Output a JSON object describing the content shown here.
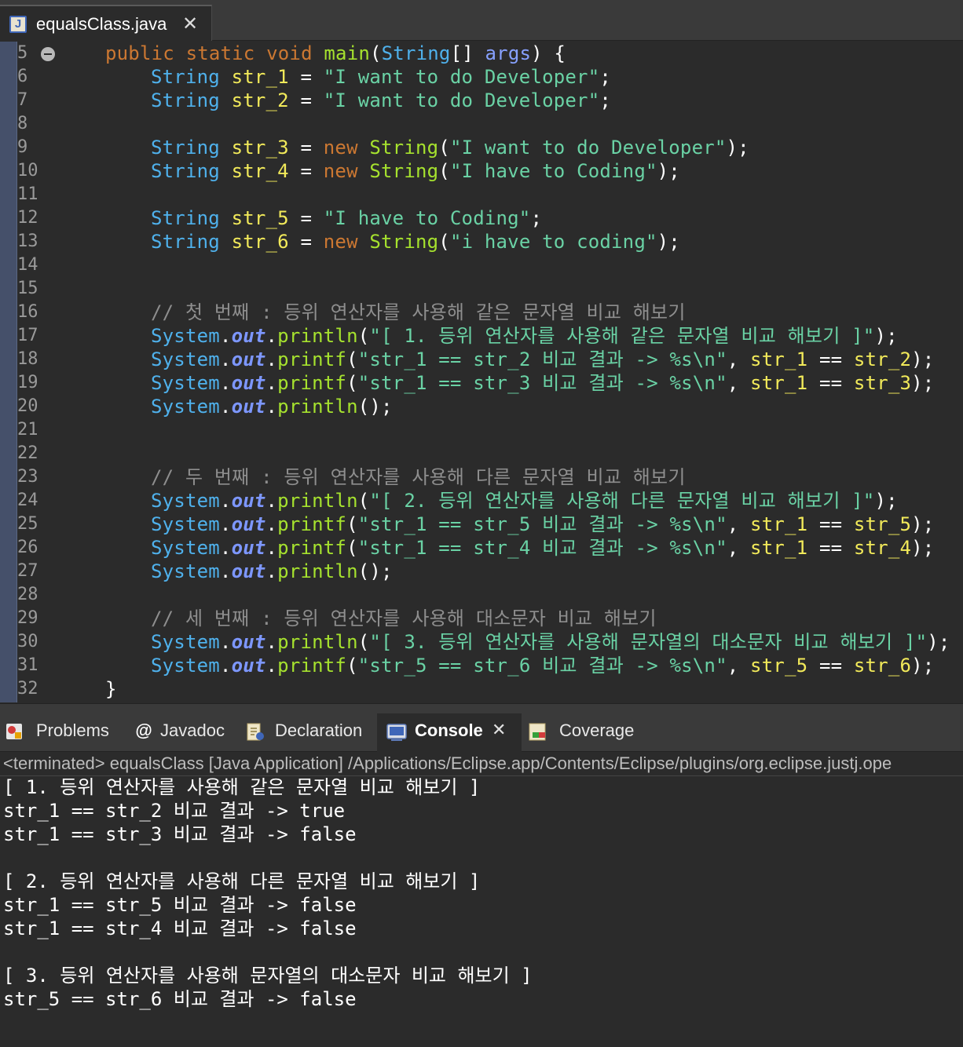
{
  "editor_tab": {
    "title": "equalsClass.java",
    "file_icon_letter": "J"
  },
  "line_numbers": [
    "5",
    "6",
    "7",
    "8",
    "9",
    "10",
    "11",
    "12",
    "13",
    "14",
    "15",
    "16",
    "17",
    "18",
    "19",
    "20",
    "21",
    "22",
    "23",
    "24",
    "25",
    "26",
    "27",
    "28",
    "29",
    "30",
    "31",
    "32"
  ],
  "code": {
    "l5": {
      "public": "public",
      "static": "static",
      "void": "void",
      "main": "main",
      "p1": "(",
      "string": "String",
      "arr": "[] ",
      "args": "args",
      "p2": ") {"
    },
    "l6": {
      "type": "String",
      "var": "str_1",
      "eq": " = ",
      "lit": "\"I want to do Developer\"",
      "end": ";"
    },
    "l7": {
      "type": "String",
      "var": "str_2",
      "eq": " = ",
      "lit": "\"I want to do Developer\"",
      "end": ";"
    },
    "l9": {
      "type": "String",
      "var": "str_3",
      "eq": " = ",
      "new": "new",
      "cls": "String",
      "open": "(",
      "lit": "\"I want to do Developer\"",
      "end": ");"
    },
    "l10": {
      "type": "String",
      "var": "str_4",
      "eq": " = ",
      "new": "new",
      "cls": "String",
      "open": "(",
      "lit": "\"I have to Coding\"",
      "end": ");"
    },
    "l12": {
      "type": "String",
      "var": "str_5",
      "eq": " = ",
      "lit": "\"I have to Coding\"",
      "end": ";"
    },
    "l13": {
      "type": "String",
      "var": "str_6",
      "eq": " = ",
      "new": "new",
      "cls": "String",
      "open": "(",
      "lit": "\"i have to coding\"",
      "end": ");"
    },
    "l16": {
      "comment": "// 첫 번째 : 등위 연산자를 사용해 같은 문자열 비교 해보기"
    },
    "l17": {
      "sys": "System",
      "dot1": ".",
      "out": "out",
      "dot2": ".",
      "method": "println",
      "open": "(",
      "lit": "\"[ 1. 등위 연산자를 사용해 같은 문자열 비교 해보기 ]\"",
      "end": ");"
    },
    "l18": {
      "sys": "System",
      "dot1": ".",
      "out": "out",
      "dot2": ".",
      "method": "printf",
      "open": "(",
      "lit": "\"str_1 == str_2 비교 결과 -> %s\\n\"",
      "comma": ", ",
      "a": "str_1",
      "op": " == ",
      "b": "str_2",
      "end": ");"
    },
    "l19": {
      "sys": "System",
      "dot1": ".",
      "out": "out",
      "dot2": ".",
      "method": "printf",
      "open": "(",
      "lit": "\"str_1 == str_3 비교 결과 -> %s\\n\"",
      "comma": ", ",
      "a": "str_1",
      "op": " == ",
      "b": "str_3",
      "end": ");"
    },
    "l20": {
      "sys": "System",
      "dot1": ".",
      "out": "out",
      "dot2": ".",
      "method": "println",
      "end": "();"
    },
    "l23": {
      "comment": "// 두 번째 : 등위 연산자를 사용해 다른 문자열 비교 해보기"
    },
    "l24": {
      "sys": "System",
      "dot1": ".",
      "out": "out",
      "dot2": ".",
      "method": "println",
      "open": "(",
      "lit": "\"[ 2. 등위 연산자를 사용해 다른 문자열 비교 해보기 ]\"",
      "end": ");"
    },
    "l25": {
      "sys": "System",
      "dot1": ".",
      "out": "out",
      "dot2": ".",
      "method": "printf",
      "open": "(",
      "lit": "\"str_1 == str_5 비교 결과 -> %s\\n\"",
      "comma": ", ",
      "a": "str_1",
      "op": " == ",
      "b": "str_5",
      "end": ");"
    },
    "l26": {
      "sys": "System",
      "dot1": ".",
      "out": "out",
      "dot2": ".",
      "method": "printf",
      "open": "(",
      "lit": "\"str_1 == str_4 비교 결과 -> %s\\n\"",
      "comma": ", ",
      "a": "str_1",
      "op": " == ",
      "b": "str_4",
      "end": ");"
    },
    "l27": {
      "sys": "System",
      "dot1": ".",
      "out": "out",
      "dot2": ".",
      "method": "println",
      "end": "();"
    },
    "l29": {
      "comment": "// 세 번째 : 등위 연산자를 사용해 대소문자 비교 해보기"
    },
    "l30": {
      "sys": "System",
      "dot1": ".",
      "out": "out",
      "dot2": ".",
      "method": "println",
      "open": "(",
      "lit": "\"[ 3. 등위 연산자를 사용해 문자열의 대소문자 비교 해보기 ]\"",
      "end": ");"
    },
    "l31": {
      "sys": "System",
      "dot1": ".",
      "out": "out",
      "dot2": ".",
      "method": "printf",
      "open": "(",
      "lit": "\"str_5 == str_6 비교 결과 -> %s\\n\"",
      "comma": ", ",
      "a": "str_5",
      "op": " == ",
      "b": "str_6",
      "end": ");"
    },
    "l32": {
      "brace": "}"
    }
  },
  "panel_tabs": {
    "problems": "Problems",
    "javadoc": "Javadoc",
    "declaration": "Declaration",
    "console": "Console",
    "coverage": "Coverage"
  },
  "console": {
    "terminated": "<terminated> equalsClass [Java Application] /Applications/Eclipse.app/Contents/Eclipse/plugins/org.eclipse.justj.ope",
    "lines": [
      "[ 1. 등위 연산자를 사용해 같은 문자열 비교 해보기 ]",
      "str_1 == str_2 비교 결과 -> true",
      "str_1 == str_3 비교 결과 -> false",
      "",
      "[ 2. 등위 연산자를 사용해 다른 문자열 비교 해보기 ]",
      "str_1 == str_5 비교 결과 -> false",
      "str_1 == str_4 비교 결과 -> false",
      "",
      "[ 3. 등위 연산자를 사용해 문자열의 대소문자 비교 해보기 ]",
      "str_5 == str_6 비교 결과 -> false"
    ]
  },
  "colors": {
    "background": "#2b2b2b",
    "keyword": "#cc7832",
    "type": "#4fb1ec",
    "method": "#a6e22e",
    "variable": "#f2ea5a",
    "string": "#6ad2a5",
    "comment": "#8e8e8e"
  }
}
